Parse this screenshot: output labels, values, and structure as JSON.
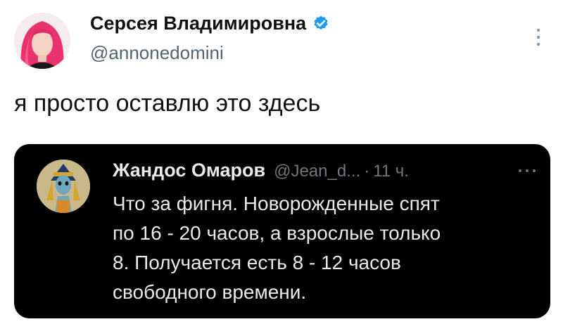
{
  "author": {
    "name": "Серсея Владимировна",
    "handle": "@annonedomini",
    "verified": true
  },
  "tweet_text": "я просто оставлю это здесь",
  "quoted_tweet": {
    "name": "Жандос Омаров",
    "handle": "@Jean_d...",
    "separator": "·",
    "time": "11 ч.",
    "lines": [
      "Что за фигня. Новорожденные спят",
      "по 16 - 20 часов, а взрослые только",
      "8. Получается есть 8 - 12 часов",
      "свободного времени."
    ]
  },
  "colors": {
    "verified": "#1d9bf0",
    "handle_gray": "#536471",
    "quote_bg": "#000000",
    "quote_text": "#e7e9ea",
    "quote_meta": "#71767b"
  },
  "icons": [
    "verified-badge-icon",
    "more-vertical-icon",
    "more-horizontal-icon"
  ]
}
